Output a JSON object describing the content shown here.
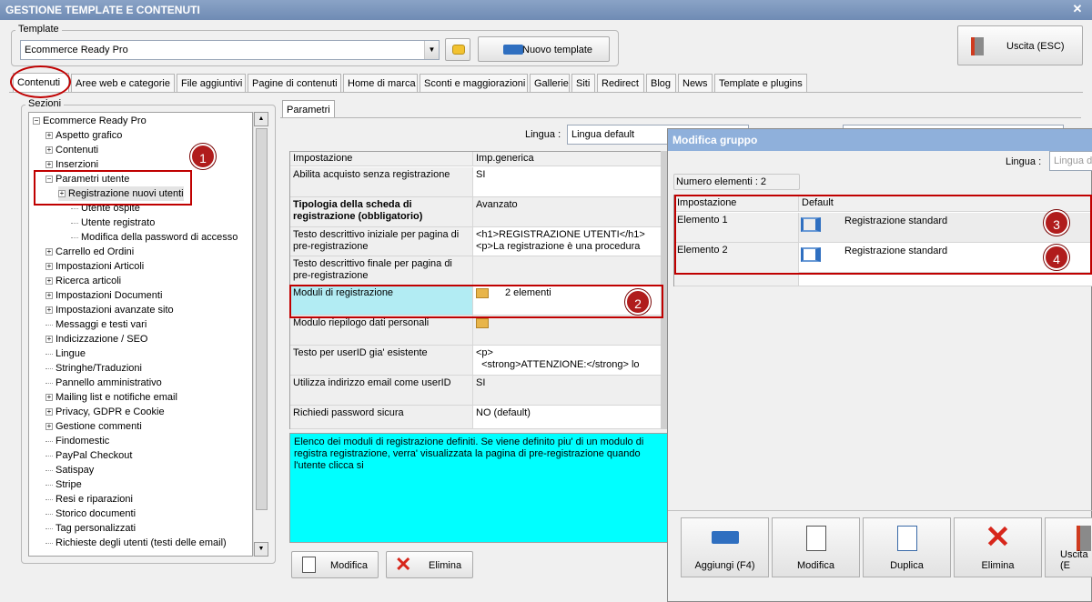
{
  "window": {
    "title": "GESTIONE TEMPLATE E CONTENUTI"
  },
  "template": {
    "legend": "Template",
    "selected": "Ecommerce Ready Pro",
    "new_button": "Nuovo template"
  },
  "exit_button": "Uscita (ESC)",
  "tabs": [
    "Contenuti",
    "Aree web e categorie",
    "File aggiuntivi",
    "Pagine di contenuti",
    "Home di marca",
    "Sconti e maggiorazioni",
    "Gallerie",
    "Siti",
    "Redirect",
    "Blog",
    "News",
    "Template e plugins"
  ],
  "sections": {
    "legend": "Sezioni",
    "items": [
      {
        "label": "Ecommerce Ready Pro",
        "exp": "−"
      },
      {
        "label": "Aspetto grafico",
        "exp": "+"
      },
      {
        "label": "Contenuti",
        "exp": "+"
      },
      {
        "label": "Inserzioni",
        "exp": "+"
      },
      {
        "label": "Parametri utente",
        "exp": "−"
      },
      {
        "label": "Registrazione nuovi utenti",
        "exp": "+"
      },
      {
        "label": "Utente ospite",
        "exp": ""
      },
      {
        "label": "Utente registrato",
        "exp": ""
      },
      {
        "label": "Modifica della password di accesso",
        "exp": ""
      },
      {
        "label": "Carrello ed Ordini",
        "exp": "+"
      },
      {
        "label": "Impostazioni Articoli",
        "exp": "+"
      },
      {
        "label": "Ricerca articoli",
        "exp": "+"
      },
      {
        "label": "Impostazioni Documenti",
        "exp": "+"
      },
      {
        "label": "Impostazioni avanzate sito",
        "exp": "+"
      },
      {
        "label": "Messaggi e testi vari",
        "exp": ""
      },
      {
        "label": "Indicizzazione / SEO",
        "exp": "+"
      },
      {
        "label": "Lingue",
        "exp": ""
      },
      {
        "label": "Stringhe/Traduzioni",
        "exp": ""
      },
      {
        "label": "Pannello amministrativo",
        "exp": ""
      },
      {
        "label": "Mailing list e notifiche email",
        "exp": "+"
      },
      {
        "label": "Privacy, GDPR e Cookie",
        "exp": "+"
      },
      {
        "label": "Gestione commenti",
        "exp": "+"
      },
      {
        "label": "Findomestic",
        "exp": ""
      },
      {
        "label": "PayPal Checkout",
        "exp": ""
      },
      {
        "label": "Satispay",
        "exp": ""
      },
      {
        "label": "Stripe",
        "exp": ""
      },
      {
        "label": "Resi e riparazioni",
        "exp": ""
      },
      {
        "label": "Storico documenti",
        "exp": ""
      },
      {
        "label": "Tag personalizzati",
        "exp": ""
      },
      {
        "label": "Richieste degli utenti (testi delle email)",
        "exp": ""
      }
    ]
  },
  "params": {
    "tab": "Parametri",
    "lang_label": "Lingua :",
    "lang_value": "Lingua default",
    "col_setting": "Impostazione",
    "col_value": "Imp.generica",
    "rows": [
      {
        "name": "Abilita acquisto senza registrazione",
        "value": "SI"
      },
      {
        "name": "Tipologia della scheda di registrazione (obbligatorio)",
        "value": "Avanzato"
      },
      {
        "name": "Testo descrittivo iniziale per pagina di pre-registrazione",
        "value": "<h1>REGISTRAZIONE UTENTI</h1>\n<p>La registrazione è una procedura"
      },
      {
        "name": "Testo descrittivo finale per pagina di pre-registrazione",
        "value": ""
      },
      {
        "name": "Moduli di registrazione",
        "value": "2 elementi"
      },
      {
        "name": "Modulo riepilogo dati personali",
        "value": ""
      },
      {
        "name": "Testo per userID gia' esistente",
        "value": "<p>\n  <strong>ATTENZIONE:</strong> lo"
      },
      {
        "name": "Utilizza indirizzo email come userID",
        "value": "SI"
      },
      {
        "name": "Richiedi password sicura",
        "value": "NO (default)"
      }
    ],
    "description": "Elenco dei moduli di registrazione definiti. Se viene definito piu' di un modulo di registra registrazione, verra' visualizzata la pagina di pre-registrazione quando l'utente clicca si",
    "edit_button": "Modifica",
    "delete_button": "Elimina"
  },
  "dialog": {
    "title": "Modifica gruppo",
    "lang_label": "Lingua :",
    "lang_placeholder": "Lingua de",
    "count": "Numero elementi : 2",
    "col_setting": "Impostazione",
    "col_default": "Default",
    "rows": [
      {
        "name": "Elemento 1",
        "value": "Registrazione standard"
      },
      {
        "name": "Elemento 2",
        "value": "Registrazione standard"
      }
    ],
    "buttons": [
      "Aggiungi (F4)",
      "Modifica",
      "Duplica",
      "Elimina",
      "Uscita (E"
    ]
  },
  "callouts": [
    "1",
    "2",
    "3",
    "4"
  ],
  "colors": {
    "title_bar": "#7a95bd",
    "highlight_row": "#b2ecf3",
    "description_bg": "#00ffff",
    "annotation": "#c00000"
  }
}
